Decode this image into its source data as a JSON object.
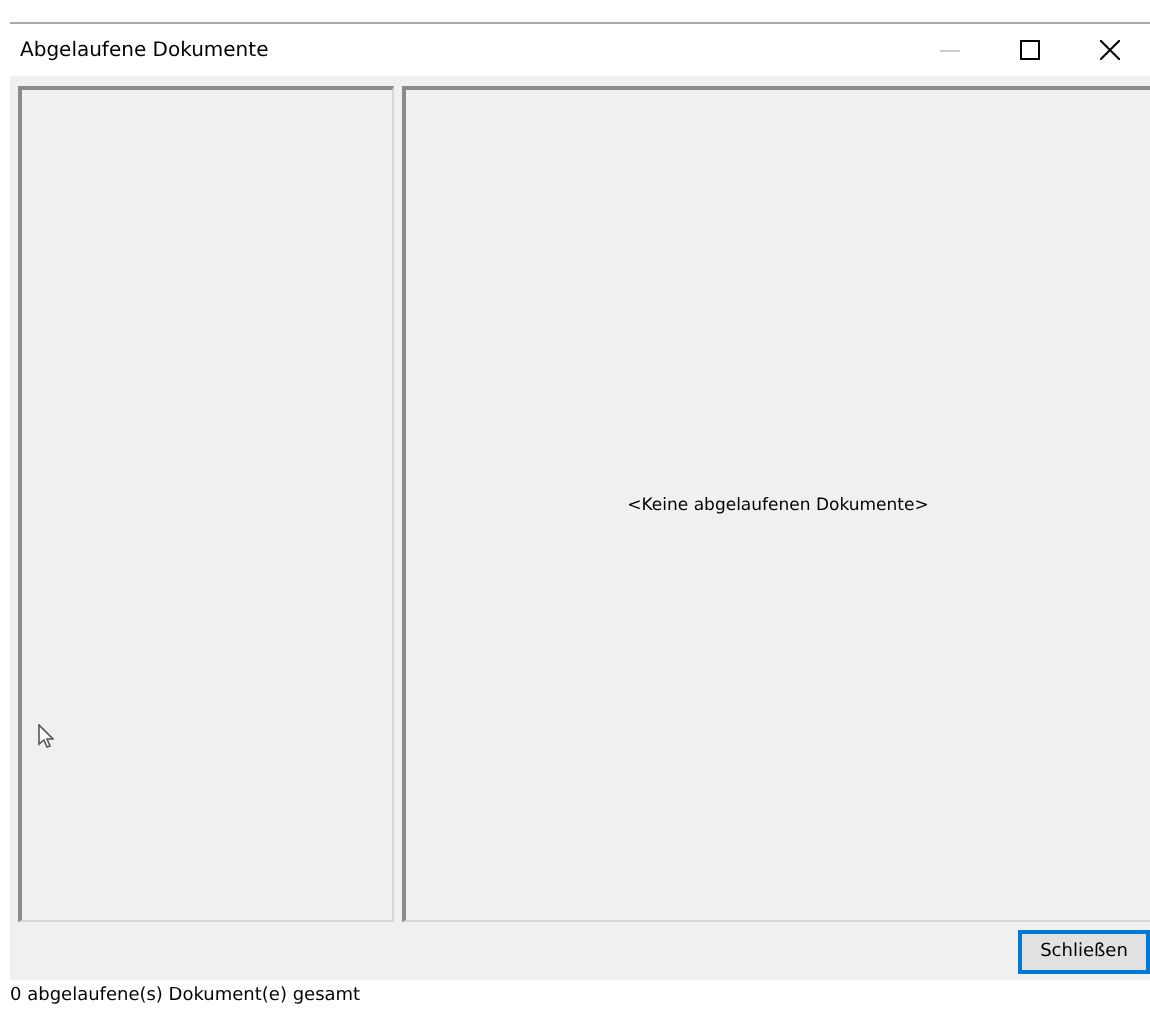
{
  "window": {
    "title": "Abgelaufene Dokumente"
  },
  "document_view": {
    "empty_message": "<Keine abgelaufenen Dokumente>"
  },
  "buttons": [
    "Schließen"
  ],
  "status_bar": {
    "text": "0 abgelaufene(s) Dokument(e) gesamt"
  }
}
